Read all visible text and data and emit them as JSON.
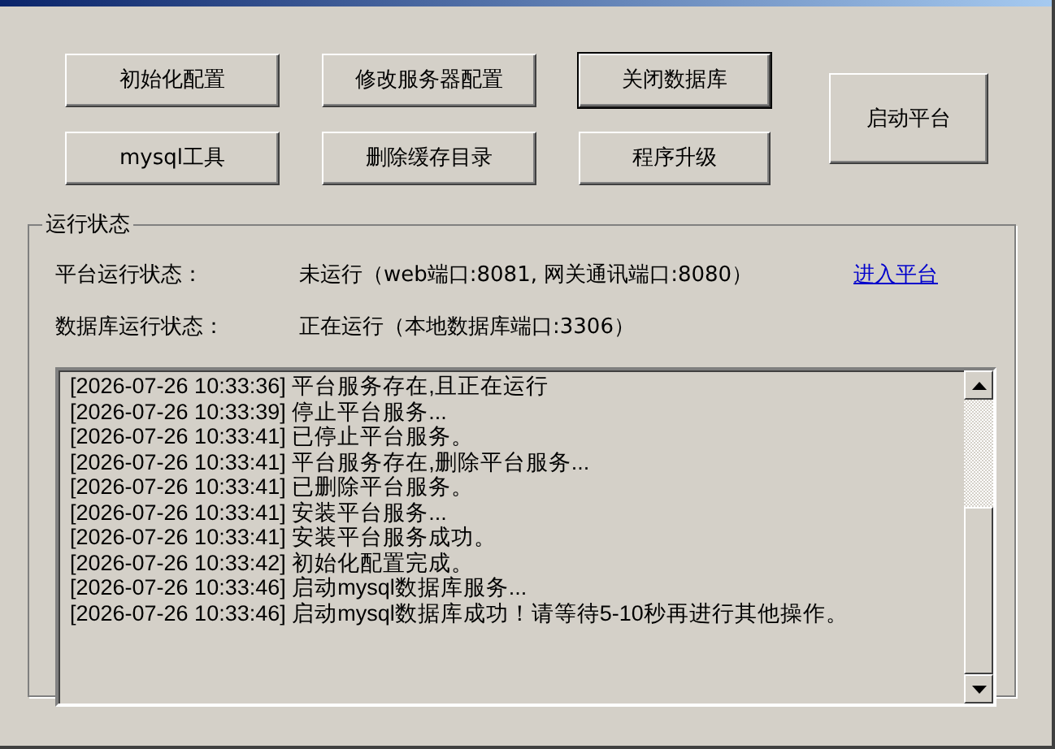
{
  "buttons": [
    {
      "label": "初始化配置",
      "default": false
    },
    {
      "label": "修改服务器配置",
      "default": false
    },
    {
      "label": "关闭数据库",
      "default": true
    },
    {
      "label": "mysql工具",
      "default": false
    },
    {
      "label": "删除缓存目录",
      "default": false
    },
    {
      "label": "程序升级",
      "default": false
    }
  ],
  "start_button": {
    "label": "启动平台"
  },
  "status_group": {
    "title": "运行状态",
    "rows": [
      {
        "label": "平台运行状态：",
        "value": "未运行（web端口:8081, 网关通讯端口:8080）",
        "link": "进入平台"
      },
      {
        "label": "数据库运行状态：",
        "value": "正在运行（本地数据库端口:3306）"
      }
    ]
  },
  "log": [
    "[2026-07-26 10:33:36] 平台服务存在,且正在运行",
    "[2026-07-26 10:33:39] 停止平台服务...",
    "[2026-07-26 10:33:41] 已停止平台服务。",
    "[2026-07-26 10:33:41] 平台服务存在,删除平台服务...",
    "[2026-07-26 10:33:41] 已删除平台服务。",
    "[2026-07-26 10:33:41] 安装平台服务...",
    "[2026-07-26 10:33:41] 安装平台服务成功。",
    "[2026-07-26 10:33:42] 初始化配置完成。",
    "[2026-07-26 10:33:46] 启动mysql数据库服务...",
    "[2026-07-26 10:33:46] 启动mysql数据库成功！请等待5-10秒再进行其他操作。"
  ]
}
